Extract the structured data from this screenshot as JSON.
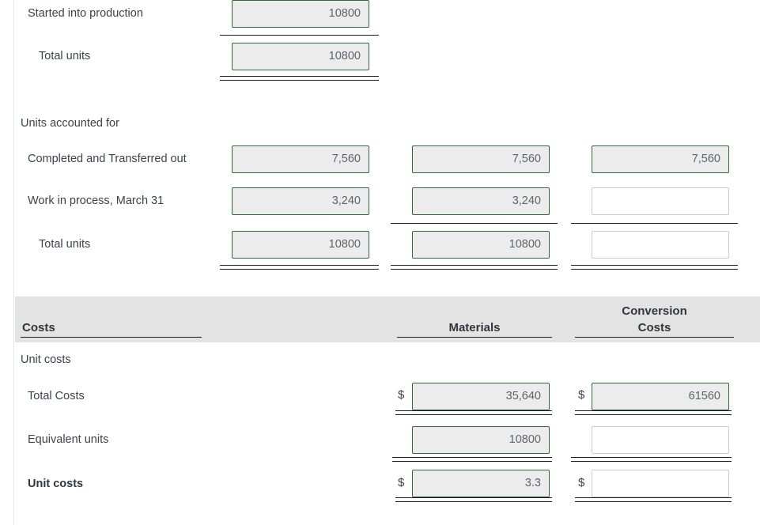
{
  "theme": {
    "accent_border": "#2f6b35",
    "filled_bg": "#ececec",
    "empty_border": "#cccccc",
    "band_bg": "#e3e3e3",
    "text": "#3b424b"
  },
  "units_section": {
    "rows_top": [
      {
        "label": "Started into production",
        "value": "10800"
      },
      {
        "label": "Total units",
        "value": "10800"
      }
    ],
    "accounted_heading": "Units accounted for",
    "rows": [
      {
        "label": "Completed and Transferred out",
        "col1": "7,560",
        "col2": "7,560",
        "col3": "7,560",
        "col3_empty": false
      },
      {
        "label": "Work in process, March 31",
        "col1": "3,240",
        "col2": "3,240",
        "col3": "",
        "col3_empty": true
      },
      {
        "label": "Total units",
        "col1": "10800",
        "col2": "10800",
        "col3": "",
        "col3_empty": true
      }
    ]
  },
  "costs_section": {
    "header": {
      "costs": "Costs",
      "materials": "Materials",
      "conversion_line1": "Conversion",
      "conversion_line2": "Costs"
    },
    "unit_costs_heading": "Unit costs",
    "rows": [
      {
        "label": "Total Costs",
        "bold": false,
        "materials_dollar": "$",
        "materials": "35,640",
        "materials_empty": false,
        "conversion_dollar": "$",
        "conversion": "61560",
        "conversion_empty": false
      },
      {
        "label": "Equivalent units",
        "bold": false,
        "materials_dollar": "",
        "materials": "10800",
        "materials_empty": false,
        "conversion_dollar": "",
        "conversion": "",
        "conversion_empty": true
      },
      {
        "label": "Unit costs",
        "bold": true,
        "materials_dollar": "$",
        "materials": "3.3",
        "materials_empty": false,
        "conversion_dollar": "$",
        "conversion": "",
        "conversion_empty": true
      }
    ]
  }
}
